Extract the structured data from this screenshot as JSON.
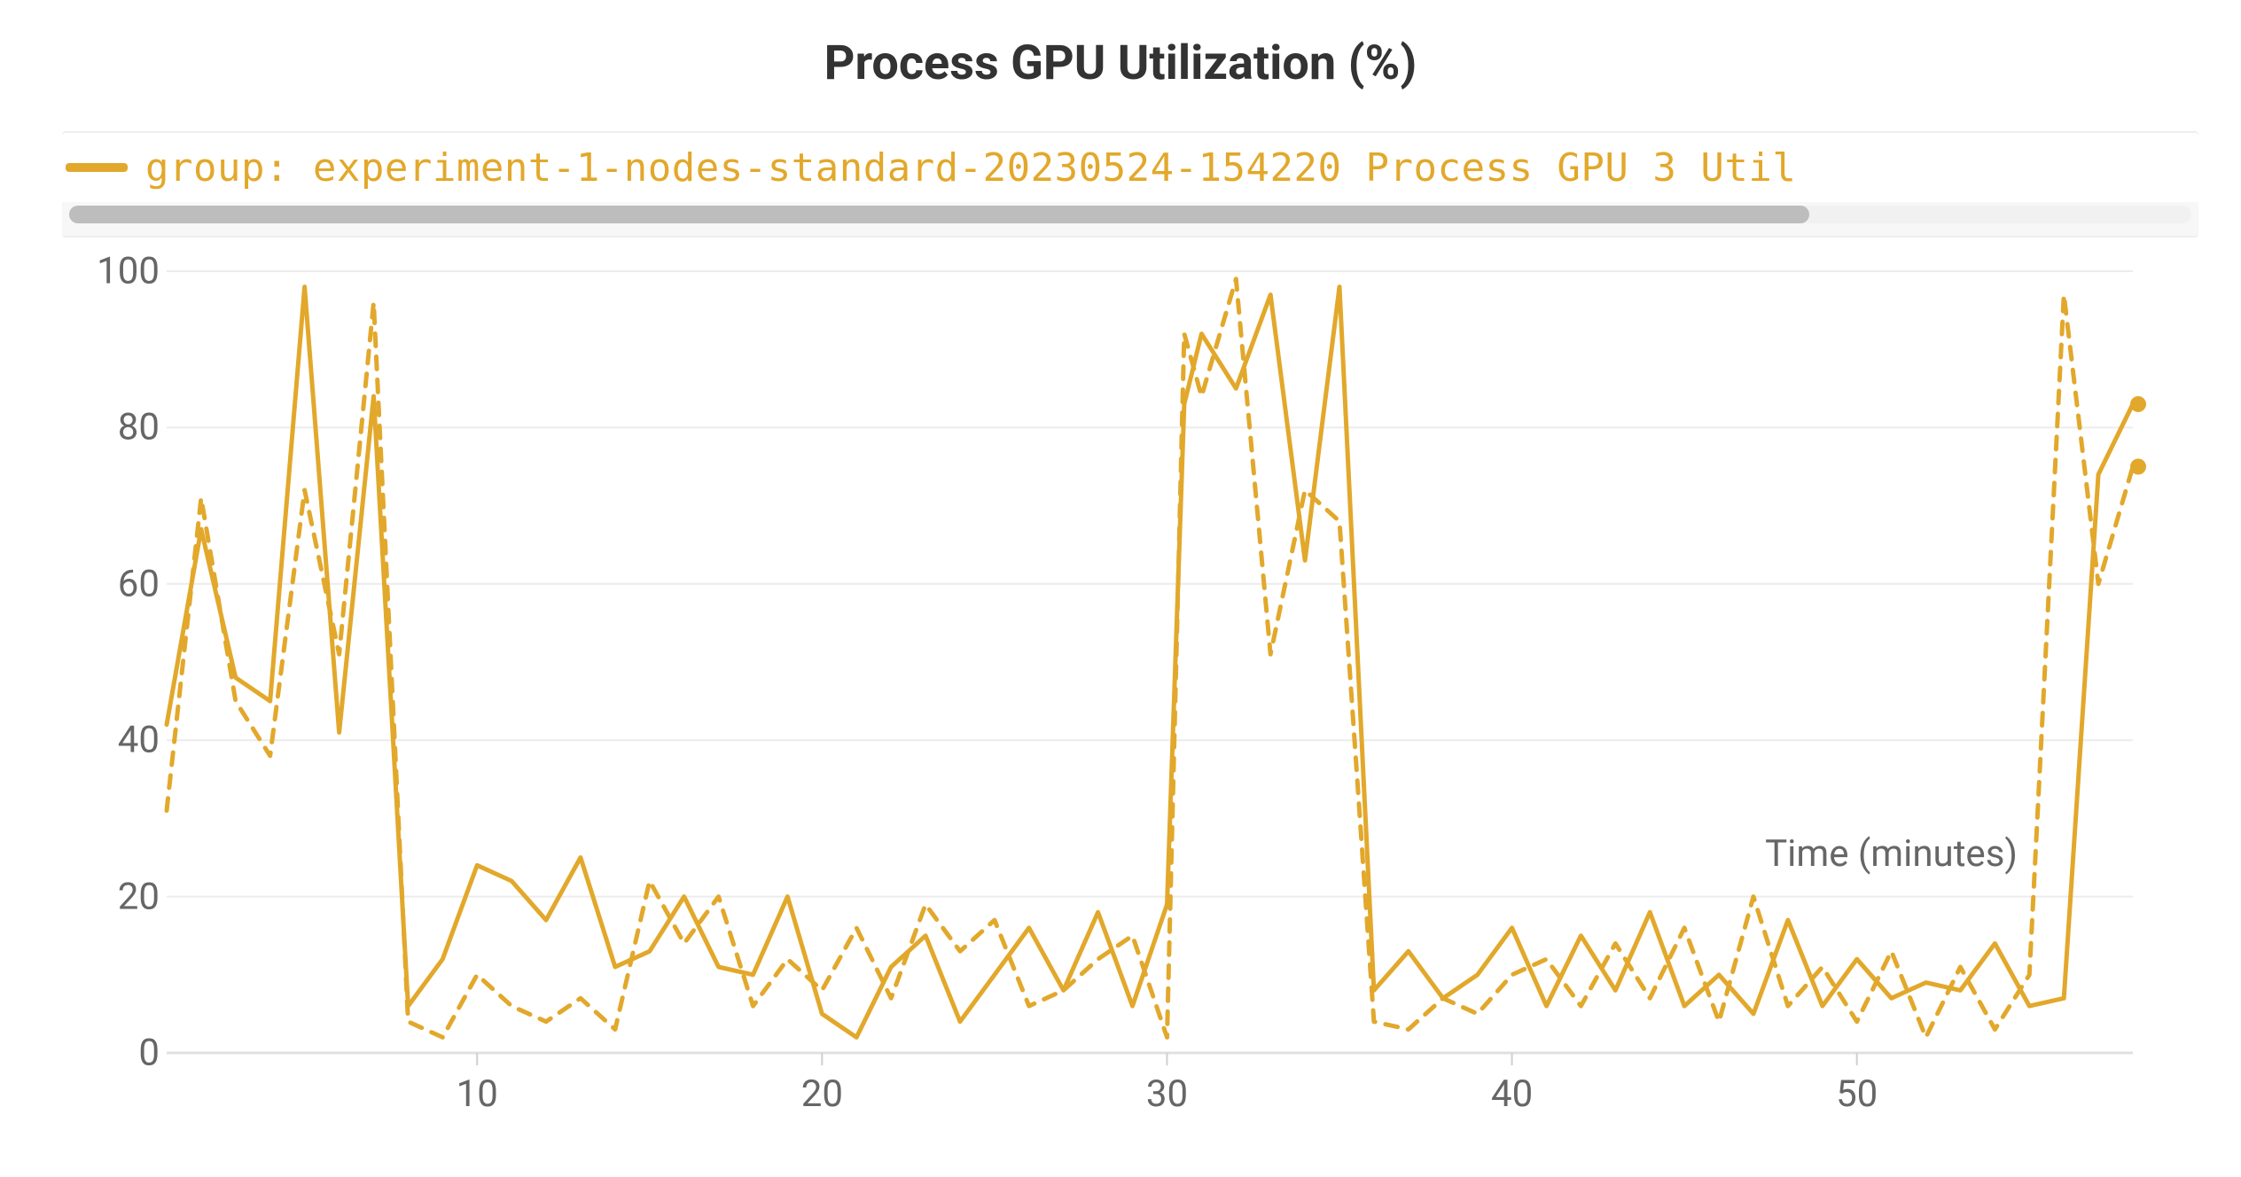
{
  "chart_data": {
    "type": "line",
    "title": "Process GPU Utilization (%)",
    "xlabel": "Time (minutes)",
    "ylabel": "",
    "ylim": [
      0,
      100
    ],
    "xlim": [
      1,
      58
    ],
    "x_ticks": [
      10,
      20,
      30,
      40,
      50
    ],
    "y_ticks": [
      0,
      20,
      40,
      60,
      80,
      100
    ],
    "legend_text": "group: experiment-1-nodes-standard-20230524-154220 Process GPU 3 Util",
    "legend_scroll_fraction": 0.82,
    "series_color": "#e2a82b",
    "series": [
      {
        "name": "solid",
        "style": "solid",
        "x": [
          1,
          2,
          3,
          4,
          5,
          6,
          7,
          8,
          9,
          10,
          11,
          12,
          13,
          14,
          15,
          16,
          17,
          18,
          19,
          20,
          21,
          22,
          23,
          24,
          25,
          26,
          27,
          28,
          29,
          30,
          30.5,
          31,
          32,
          33,
          34,
          35,
          36,
          37,
          38,
          39,
          40,
          41,
          42,
          43,
          44,
          45,
          46,
          47,
          48,
          49,
          50,
          51,
          52,
          53,
          54,
          55,
          56,
          57,
          58
        ],
        "values": [
          42,
          67,
          48,
          45,
          98,
          41,
          84,
          6,
          12,
          24,
          22,
          17,
          25,
          11,
          13,
          20,
          11,
          10,
          20,
          5,
          2,
          11,
          15,
          4,
          10,
          16,
          8,
          18,
          6,
          19,
          83,
          92,
          85,
          97,
          63,
          98,
          8,
          13,
          7,
          10,
          16,
          6,
          15,
          8,
          18,
          6,
          10,
          5,
          17,
          6,
          12,
          7,
          9,
          8,
          14,
          6,
          7,
          74,
          83
        ]
      },
      {
        "name": "dashed",
        "style": "dashed",
        "x": [
          1,
          2,
          3,
          4,
          5,
          6,
          7,
          8,
          9,
          10,
          11,
          12,
          13,
          14,
          15,
          16,
          17,
          18,
          19,
          20,
          21,
          22,
          23,
          24,
          25,
          26,
          27,
          28,
          29,
          30,
          30.5,
          31,
          32,
          33,
          34,
          35,
          36,
          37,
          38,
          39,
          40,
          41,
          42,
          43,
          44,
          45,
          46,
          47,
          48,
          49,
          50,
          51,
          52,
          53,
          54,
          55,
          56,
          57,
          58
        ],
        "values": [
          31,
          71,
          45,
          38,
          72,
          51,
          96,
          4,
          2,
          10,
          6,
          4,
          7,
          3,
          22,
          14,
          20,
          6,
          12,
          8,
          16,
          7,
          19,
          13,
          17,
          6,
          8,
          12,
          15,
          2,
          92,
          84,
          99,
          51,
          72,
          68,
          4,
          3,
          7,
          5,
          10,
          12,
          6,
          14,
          7,
          16,
          4,
          20,
          6,
          11,
          4,
          13,
          2,
          11,
          3,
          10,
          97,
          60,
          75
        ]
      }
    ]
  }
}
